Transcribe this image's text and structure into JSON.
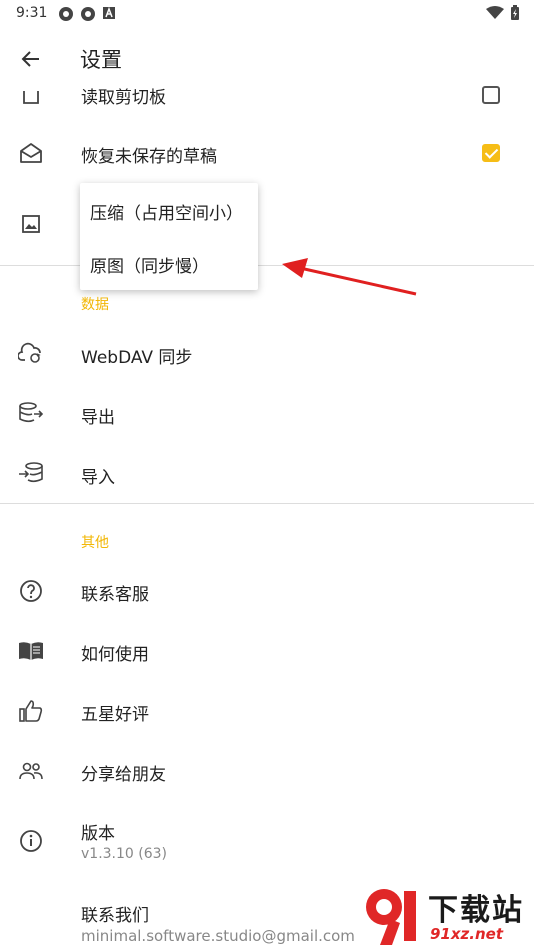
{
  "status": {
    "time": "9:31"
  },
  "appbar": {
    "title": "设置"
  },
  "items": {
    "clipboard": {
      "label": "读取剪切板",
      "checked": false
    },
    "draft": {
      "label": "恢复未保存的草稿",
      "checked": true
    }
  },
  "popup": {
    "options": [
      "压缩（占用空间小）",
      "原图（同步慢）"
    ]
  },
  "section_data": {
    "header": "数据",
    "items": [
      "WebDAV 同步",
      "导出",
      "导入"
    ]
  },
  "section_other": {
    "header": "其他",
    "items": [
      "联系客服",
      "如何使用",
      "五星好评",
      "分享给朋友"
    ],
    "version_label": "版本",
    "version_value": "v1.3.10 (63)",
    "contact_label": "联系我们",
    "contact_email": "minimal.software.studio@gmail.com"
  },
  "watermark": {
    "title": "下载站",
    "url": "91xz.net"
  },
  "colors": {
    "accent": "#f2b705",
    "checkbox_checked": "#f6bd16",
    "arrow": "#e02020"
  }
}
